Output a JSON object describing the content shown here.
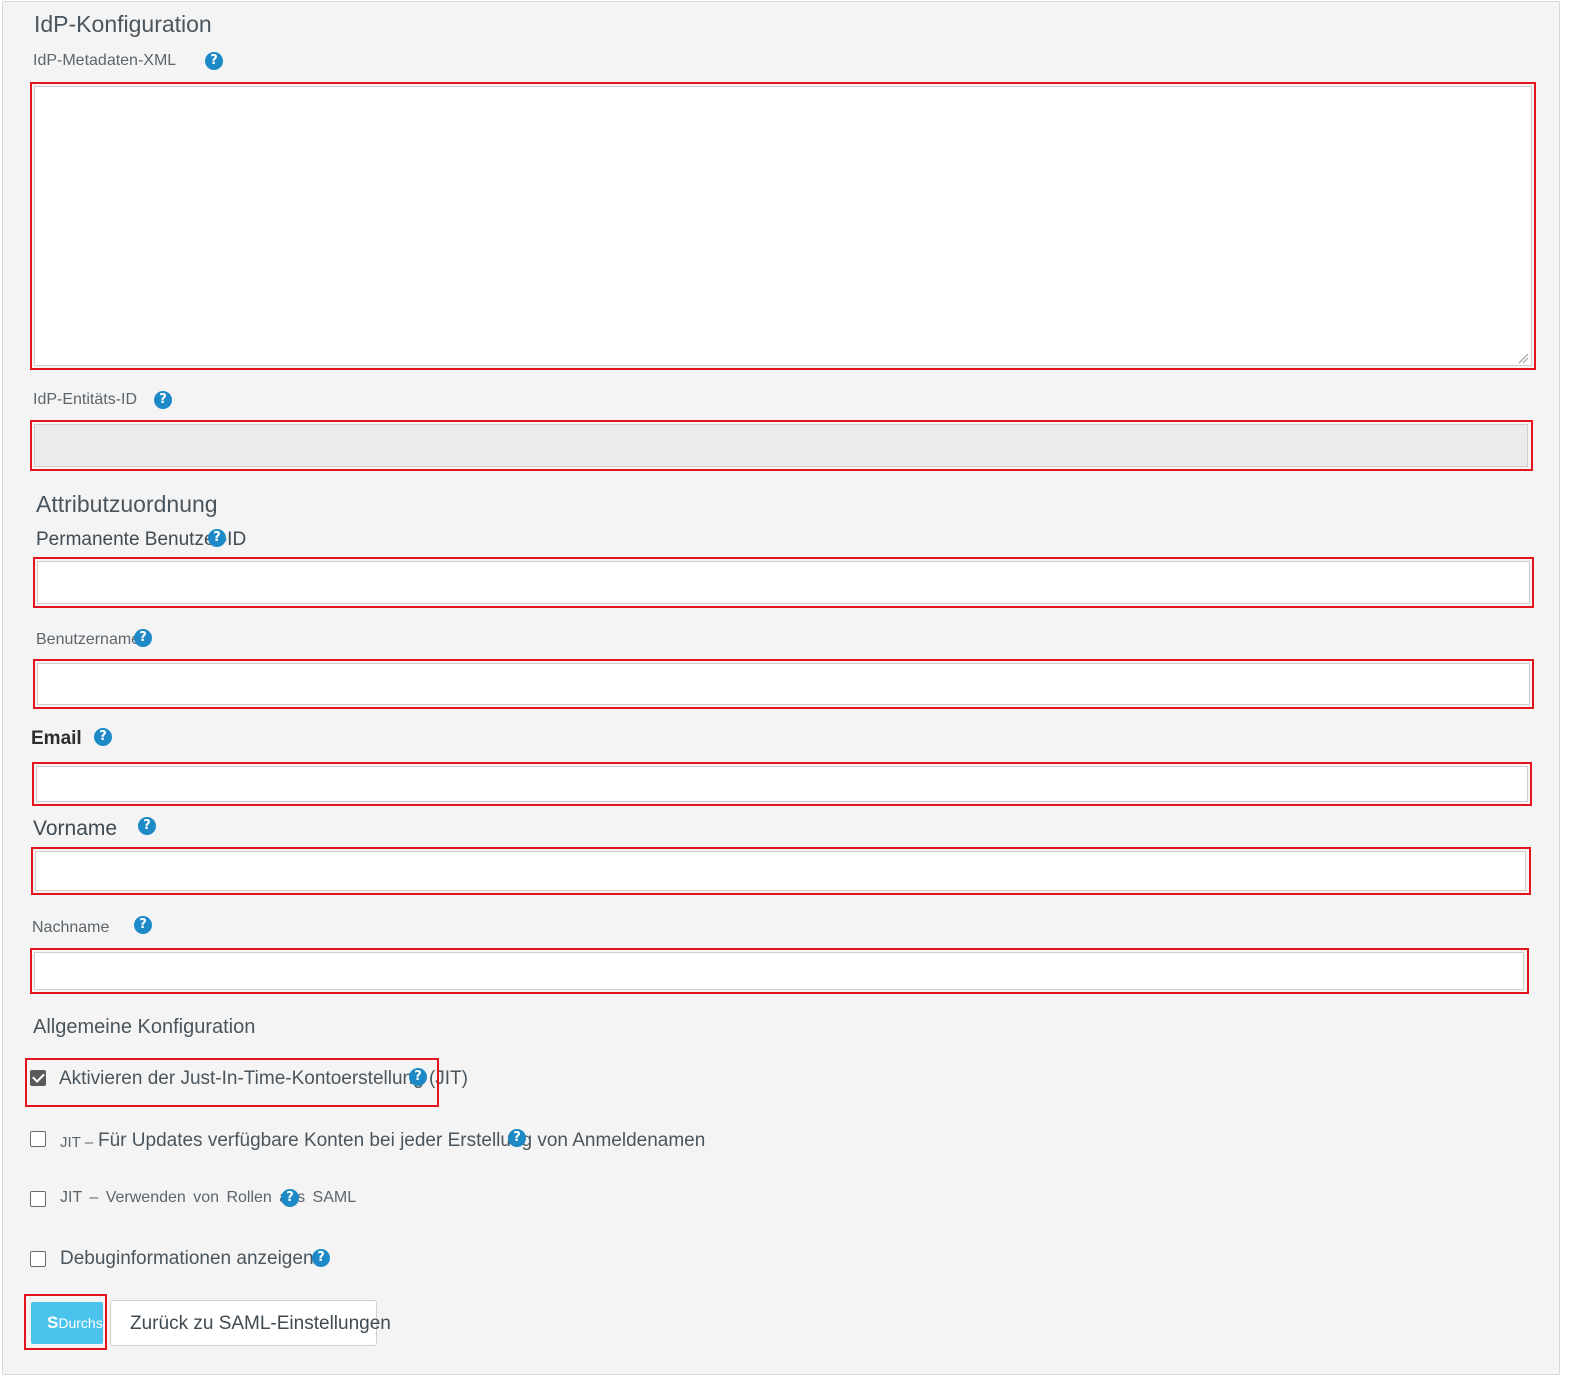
{
  "section_idp": {
    "title": "IdP-Konfiguration",
    "metadata_label": "IdP-Metadaten-XML",
    "metadata_value": "",
    "entity_id_label": "IdP-Entitäts-ID",
    "entity_id_value": ""
  },
  "section_attributes": {
    "title": "Attributzuordnung",
    "persistent_id_label": "Permanente Benutzer-ID",
    "username_label": "Benutzername",
    "email_label": "Email",
    "firstname_label": "Vorname",
    "lastname_label": "Nachname"
  },
  "section_general": {
    "title": "Allgemeine Konfiguration",
    "options": [
      {
        "label": "Aktivieren der Just-In-Time-Kontoerstellung (JIT)",
        "checked": true
      },
      {
        "prefix": "JIT –",
        "label": "Für Updates verfügbare Konten bei jeder Erstellung von Anmeldenamen",
        "checked": false
      },
      {
        "label": "JIT – Verwenden von Rollen aus SAML",
        "checked": false
      },
      {
        "label": "Debuginformationen anzeigen",
        "checked": false
      }
    ]
  },
  "buttons": {
    "save_initial": "S",
    "save_label": "Durchsuchen",
    "back_label": "Zurück zu SAML-Einstellungen"
  },
  "help_glyph": "?",
  "colors": {
    "highlight": "#e3141e",
    "help_icon": "#1d8ac7",
    "primary_button": "#4cc3ec",
    "panel_bg": "#f4f4f4"
  }
}
